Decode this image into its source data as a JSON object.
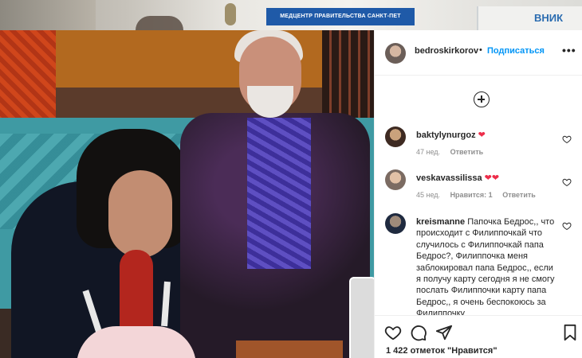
{
  "background": {
    "sign_text": "МЕДЦЕНТР ПРАВИТЕЛЬСТВА САНКТ-ПЕТ",
    "badge_text": "ВНИК"
  },
  "post": {
    "username": "bedroskirkorov",
    "dot": "•",
    "follow_label": "Подписаться",
    "more_icon": "more-dots-icon",
    "load_more_icon": "plus-circle-icon",
    "accent_color": "#0095f6"
  },
  "comments": [
    {
      "username": "baktylynurgoz",
      "text": "",
      "emoji": "❤",
      "age": "47 нед.",
      "likes": "",
      "reply_label": "Ответить"
    },
    {
      "username": "veskavassilissa",
      "text": "",
      "emoji": "❤❤",
      "age": "45 нед.",
      "likes": "Нравится: 1",
      "reply_label": "Ответить"
    },
    {
      "username": "kreismanne",
      "text": "Папочка Бедрос,, что происходит с Филиппочкай что случилось с Филиппочкай папа Бедрос?, Филиппочка меня заблокировал папа Бедрос,, если я получу карту сегодня я не смогу послать Филиппочки карту папа Бедрос,, я очень беспокоюсь за Филиппочку",
      "emoji": "",
      "age": "",
      "likes": "",
      "reply_label": ""
    }
  ],
  "actions": {
    "like_icon": "heart-icon",
    "comment_icon": "comment-icon",
    "share_icon": "paper-plane-icon",
    "save_icon": "bookmark-icon",
    "likes_text": "1 422 отметок \"Нравится\""
  }
}
